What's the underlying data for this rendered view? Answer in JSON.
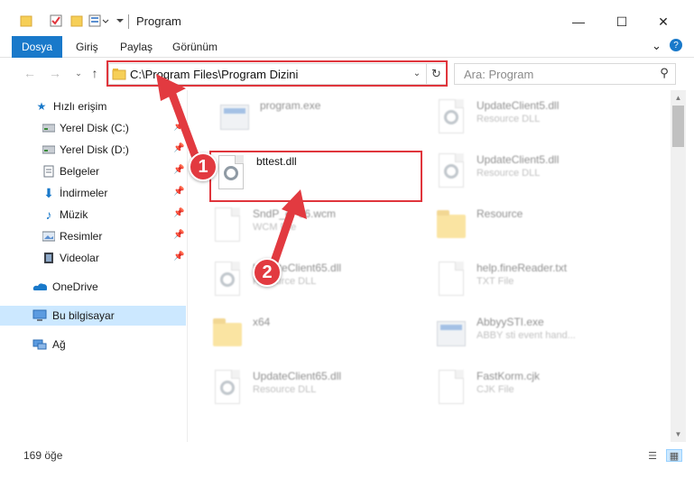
{
  "window": {
    "title": "Program",
    "minimize": "—",
    "maximize": "☐",
    "close": "✕"
  },
  "ribbon": {
    "tabs": [
      "Dosya",
      "Giriş",
      "Paylaş",
      "Görünüm"
    ],
    "expand": "⌄",
    "help": "?"
  },
  "address": {
    "path": "C:\\Program Files\\Program Dizini",
    "dropdown": "⌄",
    "refresh": "↻"
  },
  "search": {
    "placeholder": "Ara: Program"
  },
  "sidebar": {
    "items": [
      {
        "label": "Hızlı erişim",
        "icon": "star-icon"
      },
      {
        "label": "Yerel Disk (C:)",
        "icon": "drive-icon",
        "pinned": true
      },
      {
        "label": "Yerel Disk (D:)",
        "icon": "drive-icon",
        "pinned": true
      },
      {
        "label": "Belgeler",
        "icon": "documents-icon",
        "pinned": true
      },
      {
        "label": "İndirmeler",
        "icon": "download-icon",
        "pinned": true
      },
      {
        "label": "Müzik",
        "icon": "music-icon",
        "pinned": true
      },
      {
        "label": "Resimler",
        "icon": "pictures-icon",
        "pinned": true
      },
      {
        "label": "Videolar",
        "icon": "videos-icon",
        "pinned": true
      },
      {
        "label": "OneDrive",
        "icon": "cloud-icon"
      },
      {
        "label": "Bu bilgisayar",
        "icon": "computer-icon",
        "selected": true
      },
      {
        "label": "Ağ",
        "icon": "network-icon"
      }
    ]
  },
  "files": [
    {
      "name": "program.exe",
      "type": "",
      "kind": "app"
    },
    {
      "name": "UpdateClient5.dll",
      "type": "Resource DLL",
      "kind": "dll"
    },
    {
      "name": "bttest.dll",
      "type": "",
      "kind": "dll",
      "highlighted": true
    },
    {
      "name": "UpdateClient5.dll",
      "type": "Resource DLL",
      "kind": "dll"
    },
    {
      "name": "SndP_eP96.wcm",
      "type": "WCM File",
      "kind": "doc"
    },
    {
      "name": "Resource",
      "type": "",
      "kind": "folder"
    },
    {
      "name": "UpdateClient65.dll",
      "type": "Resource DLL",
      "kind": "dll"
    },
    {
      "name": "help.fineReader.txt",
      "type": "TXT File",
      "kind": "doc"
    },
    {
      "name": "x64",
      "type": "",
      "kind": "folder"
    },
    {
      "name": "AbbyySTI.exe",
      "type": "ABBY sti event hand...",
      "kind": "app"
    },
    {
      "name": "UpdateClient65.dll",
      "type": "Resource DLL",
      "kind": "dll"
    },
    {
      "name": "FastKorm.cjk",
      "type": "CJK File",
      "kind": "doc"
    }
  ],
  "status": {
    "count": "169 öğe"
  },
  "annotations": {
    "step1": "1",
    "step2": "2",
    "color": "#e23a40"
  }
}
